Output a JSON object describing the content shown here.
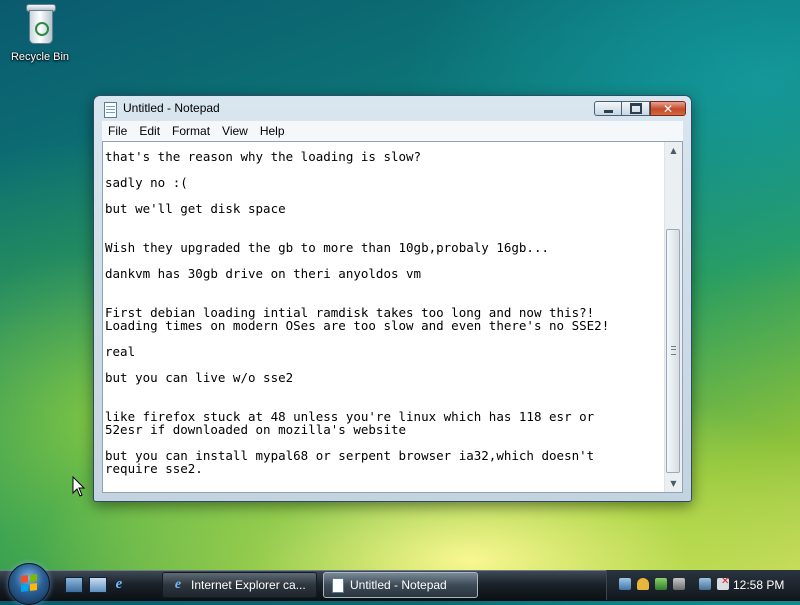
{
  "desktop": {
    "icons": [
      {
        "label": "Recycle Bin",
        "icon": "recycle-bin-icon"
      }
    ]
  },
  "window": {
    "title": "Untitled - Notepad",
    "menu": [
      "File",
      "Edit",
      "Format",
      "View",
      "Help"
    ],
    "lines": [
      "that's the reason why the loading is slow?",
      "",
      "sadly no :(",
      "",
      "but we'll get disk space",
      "",
      "",
      "Wish they upgraded the gb to more than 10gb,probaly 16gb...",
      "",
      "dankvm has 30gb drive on theri anyoldos vm",
      "",
      "",
      "First debian loading intial ramdisk takes too long and now this?!",
      "Loading times on modern OSes are too slow and even there's no SSE2!",
      "",
      "real",
      "",
      "but you can live w/o sse2",
      "",
      "",
      "like firefox stuck at 48 unless you're linux which has 118 esr or",
      "52esr if downloaded on mozilla's website",
      "",
      "but you can install mypal68 or serpent browser ia32,which doesn't",
      "require sse2."
    ]
  },
  "taskbar": {
    "buttons": [
      {
        "label": "Internet Explorer ca...",
        "icon": "internet-explorer-icon",
        "active": false
      },
      {
        "label": "Untitled - Notepad",
        "icon": "notepad-icon",
        "active": true
      }
    ],
    "clock": "12:58 PM"
  },
  "colors": {
    "title_text": "#000000",
    "close_button": "#c44a2d",
    "taskbar": "#1a2128"
  }
}
